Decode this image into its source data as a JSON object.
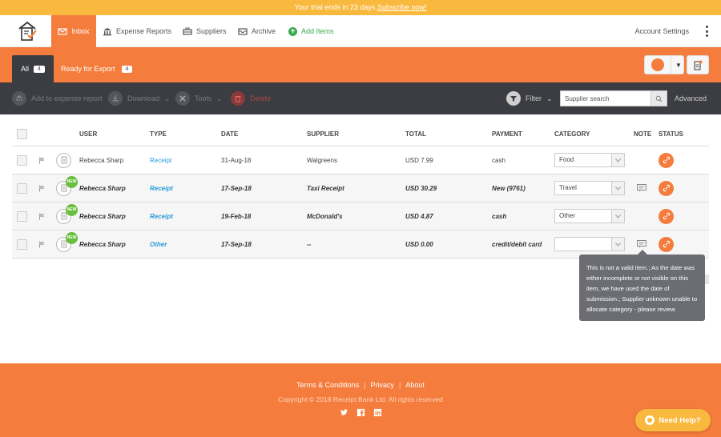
{
  "trial": {
    "text": "Your trial ends in 23 days.",
    "link": "Subscribe now!"
  },
  "nav": {
    "inbox": "Inbox",
    "expense_reports": "Expense Reports",
    "suppliers": "Suppliers",
    "archive": "Archive",
    "add_items": "Add Items",
    "account_settings": "Account Settings"
  },
  "tabs": {
    "all": {
      "label": "All",
      "count": "4"
    },
    "ready_for_export": {
      "label": "Ready for Export",
      "count": "4"
    }
  },
  "toolbar": {
    "add_to_report": "Add to expense report",
    "download": "Download",
    "tools": "Tools",
    "delete": "Delete",
    "filter": "Filter",
    "search_placeholder": "Supplier search",
    "advanced": "Advanced"
  },
  "table": {
    "columns": [
      "USER",
      "TYPE",
      "DATE",
      "SUPPLIER",
      "TOTAL",
      "PAYMENT",
      "CATEGORY",
      "NOTE",
      "STATUS"
    ],
    "rows": [
      {
        "user": "Rebecca Sharp",
        "type": "Receipt",
        "date": "31-Aug-18",
        "supplier": "Walgreens",
        "total": "USD 7.99",
        "payment": "cash",
        "category": "Food",
        "new": false,
        "note": false
      },
      {
        "user": "Rebecca Sharp",
        "type": "Receipt",
        "date": "17-Sep-18",
        "supplier": "Taxi Receipt",
        "total": "USD 30.29",
        "payment": "New (9761)",
        "category": "Travel",
        "new": true,
        "note": true
      },
      {
        "user": "Rebecca Sharp",
        "type": "Receipt",
        "date": "19-Feb-18",
        "supplier": "McDonald's",
        "total": "USD 4.87",
        "payment": "cash",
        "category": "Other",
        "new": true,
        "note": false
      },
      {
        "user": "Rebecca Sharp",
        "type": "Other",
        "date": "17-Sep-18",
        "supplier": "--",
        "total": "USD 0.00",
        "payment": "credit/debit card",
        "category": "",
        "new": true,
        "note": true
      }
    ],
    "new_badge": "NEW"
  },
  "tooltip": "This is not a valid item.; As the date was either incomplete or not visible on this item, we have used the date of submission.; Supplier unknown unable to allocate category - please review",
  "footer": {
    "terms": "Terms & Conditions",
    "privacy": "Privacy",
    "about": "About",
    "copyright": "Copyright © 2018 Receipt Bank Ltd. All rights reserved"
  },
  "help": "Need Help?",
  "colors": {
    "accent": "#f47c3c",
    "trial_bar": "#f9b93e",
    "toolbar": "#3c3d42",
    "link": "#2a9bd8",
    "new_badge": "#6bbf3f"
  }
}
